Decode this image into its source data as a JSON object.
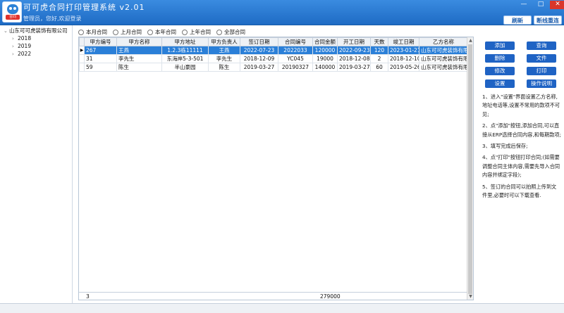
{
  "app": {
    "title": "可可虎合同打印管理系统 v2.01",
    "welcome": "管理员，您好,欢迎登录",
    "logo_text": "合同"
  },
  "window_buttons": {
    "minimize": "—",
    "maximize": "□",
    "close": "✕"
  },
  "top_buttons": {
    "refresh": "刷新",
    "reconnect": "断线重连"
  },
  "tree": {
    "root": "山东可可虎装饰有限公司",
    "children": [
      "2018",
      "2019",
      "2022"
    ]
  },
  "filters": [
    "本月合同",
    "上月合同",
    "本年合同",
    "上年合同",
    "全部合同"
  ],
  "table": {
    "columns": [
      "甲方编号",
      "甲方名称",
      "甲方地址",
      "甲方负责人",
      "签订日期",
      "合同编号",
      "合同金额",
      "开工日期",
      "天数",
      "竣工日期",
      "乙方名称"
    ],
    "rows": [
      [
        "267",
        "王燕",
        "1.2.3栋11111",
        "王燕",
        "2022-07-23",
        "2022033",
        "120000",
        "2022-09-23",
        "120",
        "2023-01-21",
        "山东可可虎装饰有限"
      ],
      [
        "31",
        "李先生",
        "东海岸5-3-501",
        "李先生",
        "2018-12-09",
        "YC045",
        "19000",
        "2018-12-08",
        "2",
        "2018-12-10",
        "山东可可虎装饰有限"
      ],
      [
        "59",
        "陈生",
        "半山豪园",
        "陈生",
        "2019-03-27",
        "20190327",
        "140000",
        "2019-03-27",
        "60",
        "2019-05-26",
        "山东可可虎装饰有限"
      ]
    ],
    "footer": {
      "count": "3",
      "total_amount": "279000"
    }
  },
  "actions": {
    "add": "添加",
    "query": "查询",
    "delete": "删除",
    "file": "文件",
    "modify": "修改",
    "print": "打印",
    "settings": "设置",
    "help": "操作说明"
  },
  "notes": [
    "1、进入\"设置\"界面设置乙方名称,地址电话等,设置不常用的款项不可见;",
    "2、点\"添加\"按钮,添加合同,可以直接从ERP选择合同内容,和每期款项;",
    "3、填写完成后保存;",
    "4、点\"打印\"按钮打印合同;(如需要调整合同主体内容,需要先导入合同内容并绑定字段);",
    "5、签订的合同可以拍照上传到文件里,必要时可以下载查看."
  ]
}
